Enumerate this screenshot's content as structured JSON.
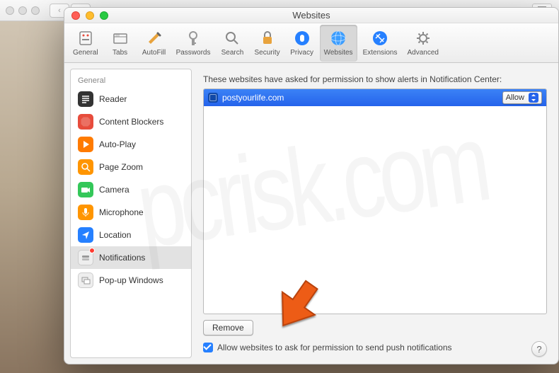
{
  "window": {
    "title": "Websites"
  },
  "toolbar": {
    "items": [
      {
        "label": "General"
      },
      {
        "label": "Tabs"
      },
      {
        "label": "AutoFill"
      },
      {
        "label": "Passwords"
      },
      {
        "label": "Search"
      },
      {
        "label": "Security"
      },
      {
        "label": "Privacy"
      },
      {
        "label": "Websites"
      },
      {
        "label": "Extensions"
      },
      {
        "label": "Advanced"
      }
    ],
    "selected_index": 7
  },
  "sidebar": {
    "header": "General",
    "items": [
      {
        "label": "Reader"
      },
      {
        "label": "Content Blockers"
      },
      {
        "label": "Auto-Play"
      },
      {
        "label": "Page Zoom"
      },
      {
        "label": "Camera"
      },
      {
        "label": "Microphone"
      },
      {
        "label": "Location"
      },
      {
        "label": "Notifications",
        "badge": true
      },
      {
        "label": "Pop-up Windows"
      }
    ],
    "selected_index": 7
  },
  "main": {
    "description": "These websites have asked for permission to show alerts in Notification Center:",
    "sites": [
      {
        "domain": "postyourlife.com",
        "permission": "Allow"
      }
    ],
    "remove_label": "Remove",
    "checkbox_label": "Allow websites to ask for permission to send push notifications",
    "checkbox_checked": true,
    "help_label": "?"
  },
  "colors": {
    "accent": "#2563eb"
  }
}
